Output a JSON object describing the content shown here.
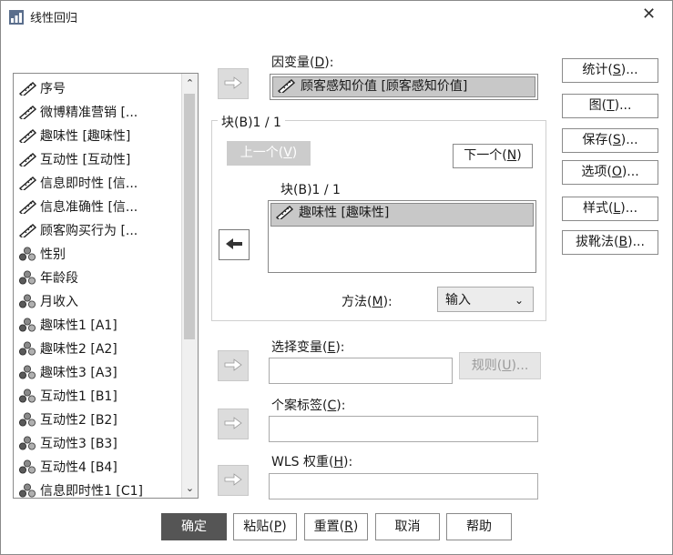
{
  "window": {
    "title": "线性回归",
    "close_glyph": "✕"
  },
  "variables": {
    "items": [
      {
        "label": "序号",
        "icon": "scale-ruler-icon"
      },
      {
        "label": "微博精准营销 [...",
        "icon": "scale-ruler-icon"
      },
      {
        "label": "趣味性 [趣味性]",
        "icon": "scale-ruler-icon"
      },
      {
        "label": "互动性 [互动性]",
        "icon": "scale-ruler-icon"
      },
      {
        "label": "信息即时性 [信...",
        "icon": "scale-ruler-icon"
      },
      {
        "label": "信息准确性 [信...",
        "icon": "scale-ruler-icon"
      },
      {
        "label": "顾客购买行为 [...",
        "icon": "scale-ruler-icon"
      },
      {
        "label": "性别",
        "icon": "nominal-balls-icon"
      },
      {
        "label": "年龄段",
        "icon": "nominal-balls-icon"
      },
      {
        "label": "月收入",
        "icon": "nominal-balls-icon"
      },
      {
        "label": "趣味性1 [A1]",
        "icon": "nominal-balls-icon"
      },
      {
        "label": "趣味性2 [A2]",
        "icon": "nominal-balls-icon"
      },
      {
        "label": "趣味性3 [A3]",
        "icon": "nominal-balls-icon"
      },
      {
        "label": "互动性1 [B1]",
        "icon": "nominal-balls-icon"
      },
      {
        "label": "互动性2 [B2]",
        "icon": "nominal-balls-icon"
      },
      {
        "label": "互动性3 [B3]",
        "icon": "nominal-balls-icon"
      },
      {
        "label": "互动性4 [B4]",
        "icon": "nominal-balls-icon"
      },
      {
        "label": "信息即时性1 [C1]",
        "icon": "nominal-balls-icon"
      }
    ]
  },
  "dependent": {
    "label_pre": "因变量(",
    "label_key": "D",
    "label_post": "):",
    "value": "顾客感知价值 [顾客感知价值]"
  },
  "block": {
    "title": "块(B)1 / 1",
    "prev": {
      "pre": "上一个(",
      "key": "V",
      "post": ")"
    },
    "next": {
      "pre": "下一个(",
      "key": "N",
      "post": ")"
    },
    "inner_title": "块(B)1 / 1",
    "items": [
      "趣味性 [趣味性]"
    ],
    "method_label": {
      "pre": "方法(",
      "key": "M",
      "post": "):"
    },
    "method_value": "输入"
  },
  "selection": {
    "label": {
      "pre": "选择变量(",
      "key": "E",
      "post": "):"
    },
    "rule_button": {
      "pre": "规则(",
      "key": "U",
      "post": ")..."
    },
    "value": ""
  },
  "case_labels": {
    "label": {
      "pre": "个案标签(",
      "key": "C",
      "post": "):"
    },
    "value": ""
  },
  "wls": {
    "label": {
      "pre": "WLS 权重(",
      "key": "H",
      "post": "):"
    },
    "value": ""
  },
  "side_buttons": [
    {
      "pre": "统计(",
      "key": "S",
      "post": ")..."
    },
    {
      "pre": "图(",
      "key": "T",
      "post": ")..."
    },
    {
      "pre": "保存(",
      "key": "S",
      "post": ")..."
    },
    {
      "pre": "选项(",
      "key": "O",
      "post": ")..."
    },
    {
      "pre": "样式(",
      "key": "L",
      "post": ")..."
    },
    {
      "pre": "拔靴法(",
      "key": "B",
      "post": ")..."
    }
  ],
  "bottom_buttons": [
    {
      "label": "确定",
      "pre": "",
      "key": "",
      "post": ""
    },
    {
      "label": "",
      "pre": "粘贴(",
      "key": "P",
      "post": ")"
    },
    {
      "label": "",
      "pre": "重置(",
      "key": "R",
      "post": ")"
    },
    {
      "label": "取消",
      "pre": "",
      "key": "",
      "post": ""
    },
    {
      "label": "帮助",
      "pre": "",
      "key": "",
      "post": ""
    }
  ],
  "colors": {
    "primary_button": "#555555",
    "disabled_button": "#cccccc",
    "selected_bg": "#c8c8c8"
  }
}
